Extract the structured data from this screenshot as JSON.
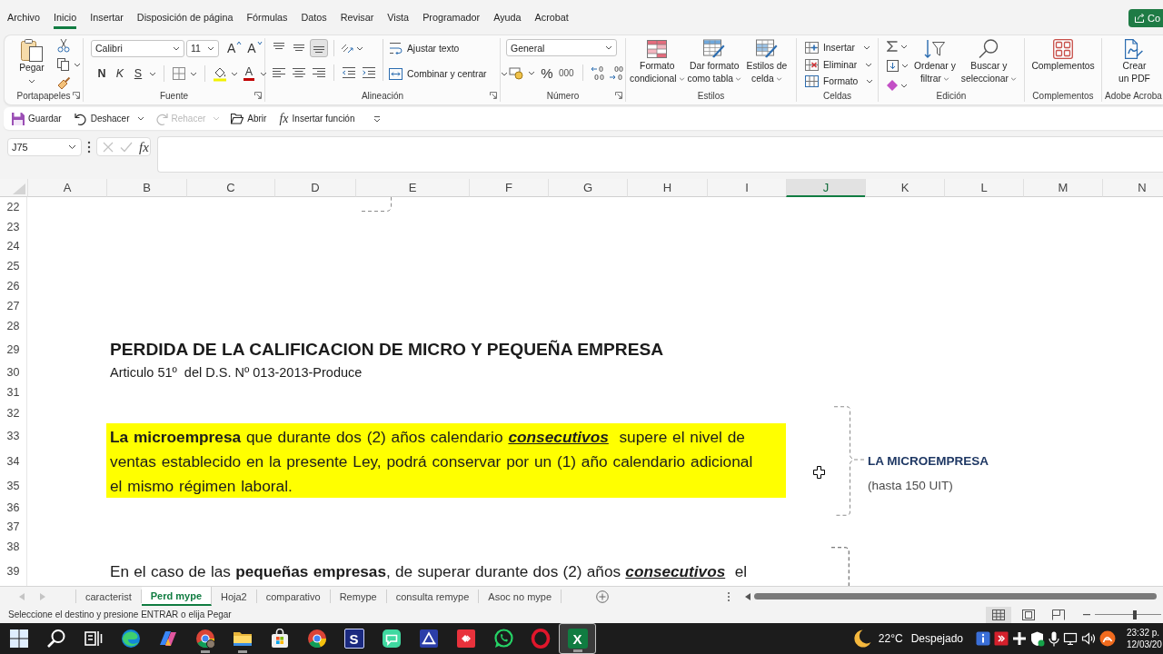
{
  "menu": {
    "tabs": [
      {
        "label": "Archivo",
        "selected": false
      },
      {
        "label": "Inicio",
        "selected": true
      },
      {
        "label": "Insertar",
        "selected": false
      },
      {
        "label": "Disposición de página",
        "selected": false
      },
      {
        "label": "Fórmulas",
        "selected": false
      },
      {
        "label": "Datos",
        "selected": false
      },
      {
        "label": "Revisar",
        "selected": false
      },
      {
        "label": "Vista",
        "selected": false
      },
      {
        "label": "Programador",
        "selected": false
      },
      {
        "label": "Ayuda",
        "selected": false
      },
      {
        "label": "Acrobat",
        "selected": false
      }
    ],
    "share_button": "Co"
  },
  "ribbon": {
    "clipboard": {
      "paste": "Pegar",
      "label": "Portapapeles"
    },
    "font": {
      "family": "Calibri",
      "size": "11",
      "grow": "A",
      "shrink": "A",
      "bold": "N",
      "italic": "K",
      "underline": "S",
      "font_color": "A",
      "label": "Fuente"
    },
    "alignment": {
      "vertical": [
        {
          "selected": false
        },
        {
          "selected": false
        },
        {
          "selected": true
        }
      ],
      "wrap_text": "Ajustar texto",
      "merge": "Combinar y centrar",
      "label": "Alineación"
    },
    "number": {
      "format": "General",
      "percent": "%",
      "thousands": "000",
      "label": "Número"
    },
    "styles": {
      "buttons": [
        {
          "lines": [
            "Formato",
            "condicional"
          ]
        },
        {
          "lines": [
            "Dar formato",
            "como tabla"
          ]
        },
        {
          "lines": [
            "Estilos de",
            "celda"
          ]
        }
      ],
      "label": "Estilos"
    },
    "cells": {
      "buttons": [
        "Insertar",
        "Eliminar",
        "Formato"
      ],
      "label": "Celdas"
    },
    "editing": {
      "buttons": [
        {
          "lines": [
            "Ordenar y",
            "filtrar"
          ]
        },
        {
          "lines": [
            "Buscar y",
            "seleccionar"
          ]
        }
      ],
      "label": "Edición"
    },
    "addins": {
      "button": "Complementos",
      "label": "Complementos"
    },
    "acrobat": {
      "lines": [
        "Crear",
        "un PDF"
      ],
      "label": "Adobe Acroba"
    }
  },
  "quick_access": [
    {
      "label": "Guardar",
      "disabled": false
    },
    {
      "label": "Deshacer",
      "disabled": false
    },
    {
      "label": "Rehacer",
      "disabled": true
    },
    {
      "label": "Abrir",
      "disabled": false
    },
    {
      "label": "Insertar función",
      "symbol": "fx",
      "disabled": false
    }
  ],
  "formula_bar": {
    "name_box": "J75",
    "function_button": "fx",
    "edit_buttons_disabled": true
  },
  "sheet": {
    "columns": [
      {
        "label": "A",
        "selected": false
      },
      {
        "label": "B",
        "selected": false
      },
      {
        "label": "C",
        "selected": false
      },
      {
        "label": "D",
        "selected": false
      },
      {
        "label": "E",
        "selected": false
      },
      {
        "label": "F",
        "selected": false
      },
      {
        "label": "G",
        "selected": false
      },
      {
        "label": "H",
        "selected": false
      },
      {
        "label": "I",
        "selected": false
      },
      {
        "label": "J",
        "selected": true
      },
      {
        "label": "K",
        "selected": false
      },
      {
        "label": "L",
        "selected": false
      },
      {
        "label": "M",
        "selected": false
      },
      {
        "label": "N",
        "selected": false
      }
    ],
    "rows": [
      "22",
      "23",
      "24",
      "25",
      "26",
      "27",
      "28",
      "29",
      "30",
      "31",
      "32",
      "33",
      "34",
      "35",
      "36",
      "37",
      "38",
      "39"
    ],
    "blocks": [
      {
        "kind": "title",
        "text": "PERDIDA DE LA CALIFICACION DE MICRO Y PEQUEÑA EMPRESA"
      },
      {
        "kind": "subtitle",
        "text": "Articulo 51º  del D.S. Nº 013-2013-Produce"
      },
      {
        "kind": "highlight",
        "lines": [
          "**La microempresa** que durante dos (2) años calendario *consecutivos*  supere el nivel de",
          "ventas establecido en la presente Ley, podrá conservar por un (1) año calendario adicional",
          "el mismo régimen laboral."
        ]
      },
      {
        "kind": "label_strong",
        "text": "LA MICROEMPRESA"
      },
      {
        "kind": "label",
        "text": "(hasta 150 UIT)"
      },
      {
        "kind": "body",
        "text": "En el caso de las **pequeñas empresas**, de superar durante dos (2) años *consecutivos*  el"
      }
    ]
  },
  "sheet_tabs": [
    {
      "label": "caracterist",
      "selected": false
    },
    {
      "label": "Perd mype",
      "selected": true
    },
    {
      "label": "Hoja2",
      "selected": false
    },
    {
      "label": "comparativo",
      "selected": false
    },
    {
      "label": "Remype",
      "selected": false
    },
    {
      "label": "consulta remype",
      "selected": false
    },
    {
      "label": "Asoc no mype",
      "selected": false
    }
  ],
  "status_bar": {
    "message": "Seleccione el destino y presione ENTRAR o elija Pegar",
    "views": [
      {
        "selected": true
      },
      {
        "selected": false
      },
      {
        "selected": false
      }
    ],
    "zoom": {
      "level": 0.6
    }
  },
  "taskbar": {
    "apps": [
      {
        "kind": "icon",
        "selected": false,
        "running": false
      },
      {
        "kind": "icon",
        "selected": false,
        "running": false
      },
      {
        "kind": "icon",
        "selected": false,
        "running": false
      },
      {
        "kind": "icon",
        "selected": false,
        "running": false
      },
      {
        "kind": "icon",
        "selected": false,
        "running": false
      },
      {
        "kind": "icon",
        "selected": false,
        "running": true
      },
      {
        "kind": "icon",
        "selected": false,
        "running": true
      },
      {
        "kind": "icon",
        "selected": false,
        "running": false
      },
      {
        "kind": "icon",
        "selected": false,
        "running": false
      },
      {
        "kind": "letter",
        "logo_text": "S",
        "selected": false,
        "running": false
      },
      {
        "kind": "icon",
        "selected": false,
        "running": false
      },
      {
        "kind": "icon",
        "selected": false,
        "running": false
      },
      {
        "kind": "icon",
        "selected": false,
        "running": false
      },
      {
        "kind": "icon",
        "selected": false,
        "running": false
      },
      {
        "kind": "icon",
        "selected": false,
        "running": false
      },
      {
        "kind": "letter",
        "logo_text": "X",
        "selected": true,
        "running": true
      }
    ],
    "weather": {
      "temperature": "22°C",
      "condition": "Despejado"
    },
    "clock": {
      "time": "23:32 p.",
      "date": "12/03/20"
    }
  }
}
